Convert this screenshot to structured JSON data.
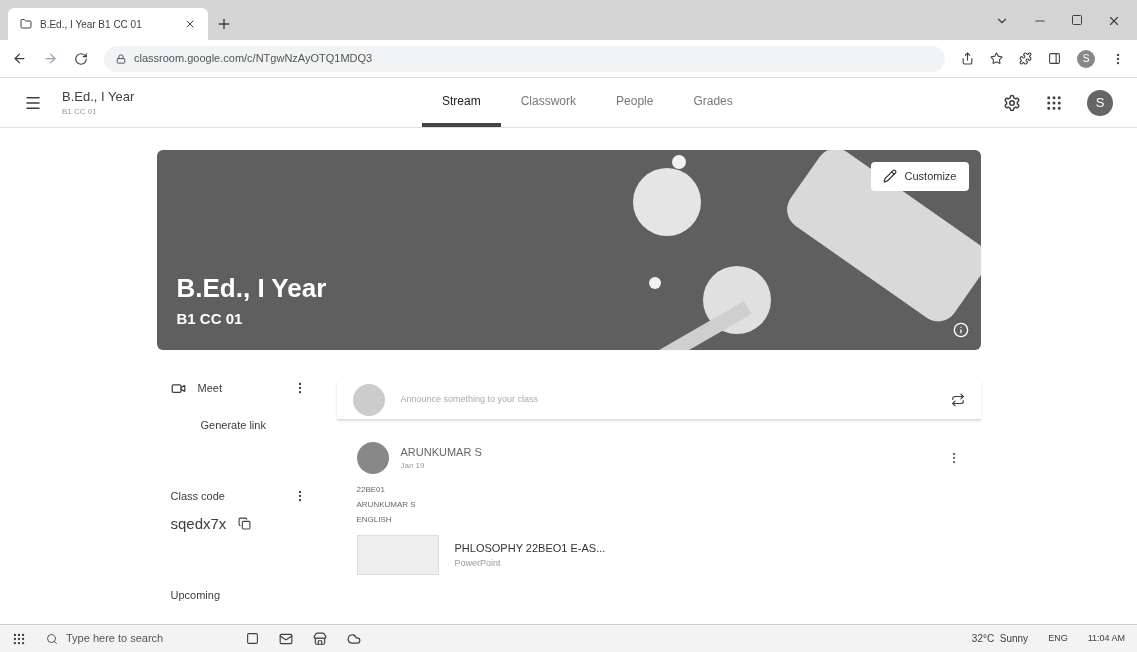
{
  "browser": {
    "tab_title": "B.Ed., I Year B1 CC 01",
    "url": "classroom.google.com/c/NTgwNzAyOTQ1MDQ3",
    "profile": "S"
  },
  "header": {
    "class_name": "B.Ed., I Year",
    "section": "B1 CC 01",
    "avatar": "S"
  },
  "tabs": [
    {
      "label": "Stream",
      "selected": true
    },
    {
      "label": "Classwork",
      "selected": false
    },
    {
      "label": "People",
      "selected": false
    },
    {
      "label": "Grades",
      "selected": false
    }
  ],
  "banner": {
    "title": "B.Ed., I Year",
    "subtitle": "B1 CC 01",
    "button": "Customize"
  },
  "sidebar": {
    "meet": "Meet",
    "generate": "Generate link",
    "class_code_label": "Class code",
    "class_code": "sqedx7x",
    "upcoming": "Upcoming"
  },
  "announce": {
    "placeholder": "Announce something to your class"
  },
  "post": {
    "author": "ARUNKUMAR S",
    "date": "Jan 19",
    "lines": [
      "22BE01",
      "ARUNKUMAR S",
      "ENGLISH"
    ],
    "attachment": {
      "title": "PHLOSOPHY 22BEO1 E-AS...",
      "type": "PowerPoint"
    }
  },
  "taskbar": {
    "search_placeholder": "Type here to search",
    "weather": "32°C  Sunny",
    "language": "ENG",
    "time": "11:04 AM"
  }
}
